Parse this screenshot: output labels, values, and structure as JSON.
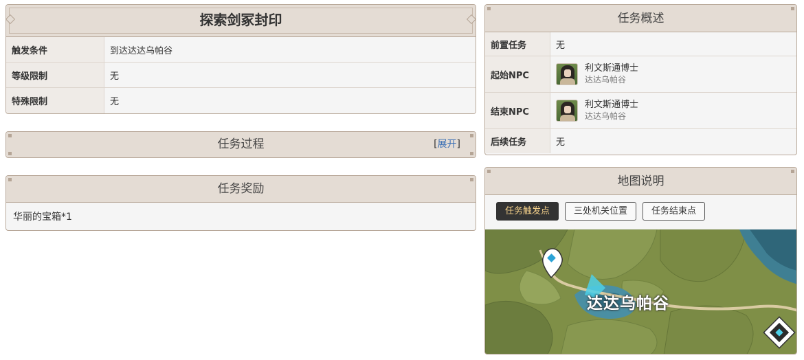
{
  "quest": {
    "title": "探索剑冢封印",
    "rows": [
      {
        "label": "触发条件",
        "value": "到达达达乌帕谷"
      },
      {
        "label": "等级限制",
        "value": "无"
      },
      {
        "label": "特殊限制",
        "value": "无"
      }
    ]
  },
  "process": {
    "title": "任务过程",
    "expand_open": "[",
    "expand_label": "展开",
    "expand_close": "]"
  },
  "reward": {
    "title": "任务奖励",
    "item": "华丽的宝箱*1"
  },
  "overview": {
    "title": "任务概述",
    "prereq_label": "前置任务",
    "prereq_value": "无",
    "start_label": "起始NPC",
    "start_npc_name": "利文斯通博士",
    "start_npc_location": "达达乌帕谷",
    "end_label": "结束NPC",
    "end_npc_name": "利文斯通博士",
    "end_npc_location": "达达乌帕谷",
    "follow_label": "后续任务",
    "follow_value": "无"
  },
  "map": {
    "title": "地图说明",
    "tabs": [
      "任务触发点",
      "三处机关位置",
      "任务结束点"
    ],
    "active_tab": 0,
    "place_label": "达达乌帕谷",
    "colors": {
      "grass": "#7f8f47",
      "water": "#4a8fa3",
      "path": "#d9cba2",
      "marker": "#4ed0e8"
    }
  }
}
